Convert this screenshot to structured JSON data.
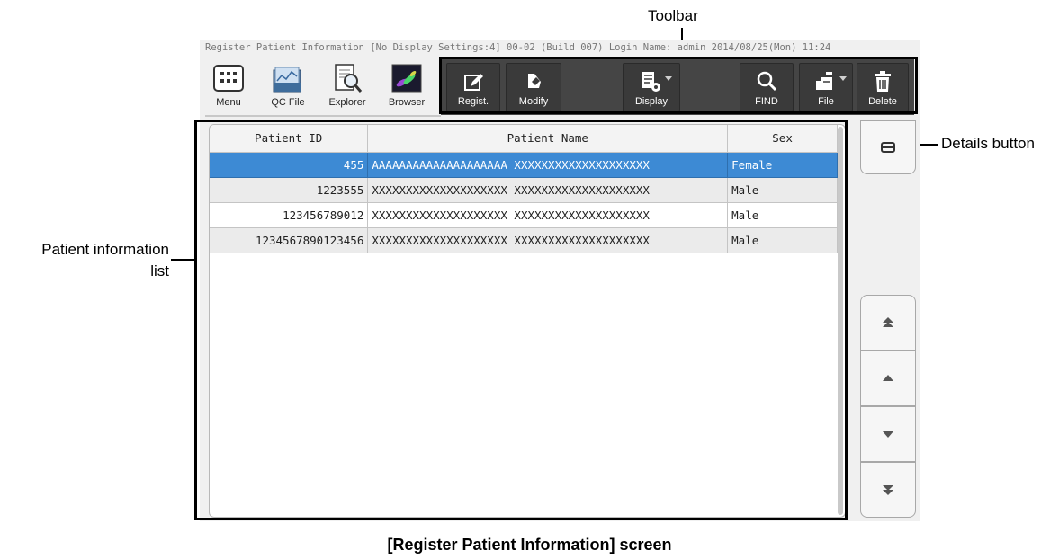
{
  "window": {
    "title_bar": "Register Patient Information [No Display Settings:4] 00-02 (Build 007) Login Name: admin  2014/08/25(Mon) 11:24"
  },
  "app_buttons": [
    {
      "label": "Menu",
      "icon": "menu-grid-icon"
    },
    {
      "label": "QC File",
      "icon": "qc-file-icon"
    },
    {
      "label": "Explorer",
      "icon": "explorer-icon"
    },
    {
      "label": "Browser",
      "icon": "browser-icon"
    }
  ],
  "toolbar": {
    "regist_label": "Regist.",
    "modify_label": "Modify",
    "display_label": "Display",
    "find_label": "FIND",
    "file_label": "File",
    "delete_label": "Delete"
  },
  "table": {
    "columns": [
      "Patient ID",
      "Patient Name",
      "Sex"
    ],
    "rows": [
      {
        "id": "455",
        "name": "AAAAAAAAAAAAAAAAAAAA XXXXXXXXXXXXXXXXXXXX",
        "sex": "Female"
      },
      {
        "id": "1223555",
        "name": "XXXXXXXXXXXXXXXXXXXX XXXXXXXXXXXXXXXXXXXX",
        "sex": "Male"
      },
      {
        "id": "123456789012",
        "name": "XXXXXXXXXXXXXXXXXXXX XXXXXXXXXXXXXXXXXXXX",
        "sex": "Male"
      },
      {
        "id": "1234567890123456",
        "name": "XXXXXXXXXXXXXXXXXXXX XXXXXXXXXXXXXXXXXXXX",
        "sex": "Male"
      }
    ]
  },
  "annotations": {
    "toolbar": "Toolbar",
    "details_button": "Details button",
    "patient_list_line1": "Patient information",
    "patient_list_line2": "list",
    "caption": "[Register Patient Information] screen"
  },
  "colors": {
    "selected_row": "#3d8ad4",
    "toolbar_bg": "#454545"
  }
}
